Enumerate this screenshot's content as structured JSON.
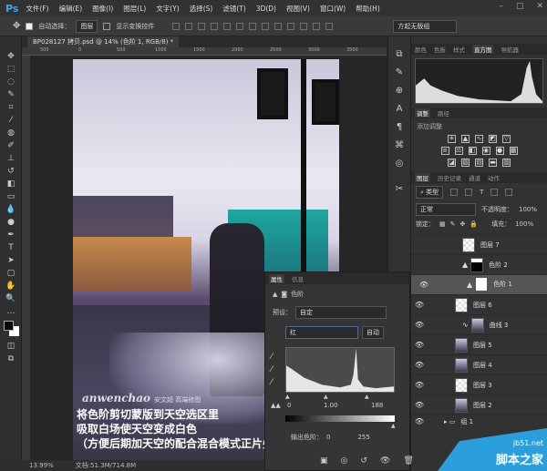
{
  "app": {
    "logo": "Ps",
    "menus": [
      "文件(F)",
      "编辑(E)",
      "图像(I)",
      "图层(L)",
      "文字(Y)",
      "选择(S)",
      "滤镜(T)",
      "3D(D)",
      "视图(V)",
      "窗口(W)",
      "帮助(H)"
    ]
  },
  "options": {
    "auto_select_label": "自动选择：",
    "auto_select_value": "图层",
    "show_transform_label": "显示变换控件",
    "workspace": "方起无版组"
  },
  "document": {
    "tab_title": "BP028127 拷贝.psd @ 14% (色阶 1, RGB/8) *",
    "ruler_ticks": [
      "500",
      "0",
      "500",
      "1000",
      "1500",
      "2000",
      "2500",
      "3000",
      "3500"
    ]
  },
  "caption": {
    "signature": "anwenchao",
    "signature_sub": "安文超 高端修图",
    "line1": "将色阶剪切蒙版到天空选区里",
    "line2": "吸取白场使天空变成白色",
    "line3": "（方便后期加天空的配合混合模式正片叠底）"
  },
  "status": {
    "zoom": "13.99%",
    "doc": "文档:51.3M/714.8M"
  },
  "histogram_panel": {
    "tabs": [
      "颜色",
      "色板",
      "样式",
      "直方图",
      "导航器"
    ],
    "active": "直方图"
  },
  "adjustments_panel": {
    "tabs": [
      "调整",
      "路径"
    ],
    "title": "添加调整"
  },
  "layers_panel": {
    "tabs": [
      "图层",
      "历史记录",
      "通道",
      "动作"
    ],
    "filter": "类型",
    "blend_mode": "正常",
    "opacity_label": "不透明度：",
    "opacity": "100%",
    "lock_label": "锁定：",
    "fill_label": "填充：",
    "fill": "100%",
    "layers": [
      {
        "name": "图层 7",
        "type": "pixel",
        "visible": false
      },
      {
        "name": "色阶 2",
        "type": "levels",
        "visible": false
      },
      {
        "name": "色阶 1",
        "type": "levels",
        "visible": true,
        "selected": true
      },
      {
        "name": "图层 6",
        "type": "pixel",
        "visible": true
      },
      {
        "name": "曲线 3",
        "type": "curves",
        "visible": true
      },
      {
        "name": "图层 5",
        "type": "photo",
        "visible": true
      },
      {
        "name": "图层 4",
        "type": "photo",
        "visible": true
      },
      {
        "name": "图层 3",
        "type": "pixel",
        "visible": true
      },
      {
        "name": "图层 2",
        "type": "photo",
        "visible": true
      },
      {
        "name": "组 1",
        "type": "group",
        "visible": true
      }
    ]
  },
  "properties": {
    "tabs": [
      "属性",
      "信息"
    ],
    "title": "色阶",
    "preset_label": "预设：",
    "preset": "自定",
    "channel": "红",
    "auto_button": "自动",
    "input_black": "0",
    "input_gamma": "1.00",
    "input_white": "188",
    "output_label": "输出色阶：",
    "output_black": "0",
    "output_white": "255"
  },
  "watermark": {
    "url": "jb51.net",
    "name": "脚本之家"
  }
}
